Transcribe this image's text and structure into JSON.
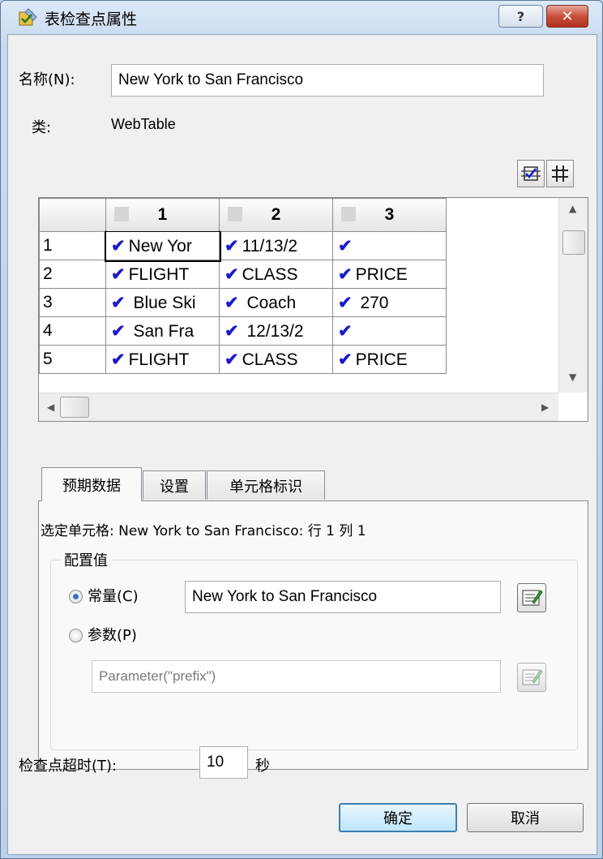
{
  "window": {
    "title": "表检查点属性",
    "help_label": "?",
    "close_label": "✕"
  },
  "name_row": {
    "label": "名称(N):",
    "value": "New York to San Francisco"
  },
  "class_row": {
    "label": "类:",
    "value": "WebTable"
  },
  "toolbar": {
    "select_all_icon": "check-all-icon",
    "grid_icon": "grid-icon"
  },
  "table": {
    "columns": [
      "1",
      "2",
      "3"
    ],
    "rows": [
      {
        "num": "1",
        "cells": [
          "New Yor",
          "11/13/2",
          ""
        ]
      },
      {
        "num": "2",
        "cells": [
          "FLIGHT",
          "CLASS",
          "PRICE"
        ]
      },
      {
        "num": "3",
        "cells": [
          " Blue Ski",
          " Coach",
          " 270"
        ]
      },
      {
        "num": "4",
        "cells": [
          " San Fra",
          " 12/13/2",
          ""
        ]
      },
      {
        "num": "5",
        "cells": [
          "FLIGHT",
          "CLASS",
          "PRICE"
        ]
      }
    ],
    "check_glyph": "✔"
  },
  "tabs": [
    {
      "label": "预期数据",
      "active": true
    },
    {
      "label": "设置",
      "active": false
    },
    {
      "label": "单元格标识",
      "active": false
    }
  ],
  "selected_cell": "选定单元格: New York to San Francisco: 行 1 列 1",
  "config": {
    "group_title": "配置值",
    "constant_label": "常量(C)",
    "constant_value": "New York to San Francisco",
    "parameter_label": "参数(P)",
    "parameter_value": "Parameter(\"prefix\")",
    "selected": "constant"
  },
  "timeout": {
    "label": "检查点超时(T):",
    "value": "10",
    "unit": "秒"
  },
  "buttons": {
    "ok": "确定",
    "cancel": "取消"
  }
}
